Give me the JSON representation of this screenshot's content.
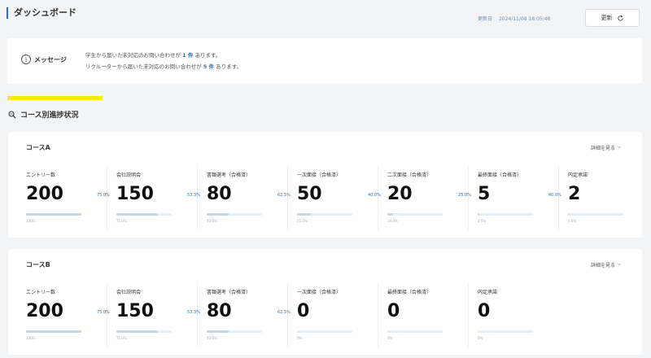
{
  "header": {
    "title": "ダッシュボード",
    "updated_label": "更新日",
    "updated_value": "2024/11/08 18:05:48",
    "refresh_label": "更新"
  },
  "message": {
    "label": "メッセージ",
    "line1_prefix": "学生から届いた未対応のお問い合わせが",
    "line1_count": "1 件",
    "line1_suffix": "あります。",
    "line2_prefix": "リクルーターから届いた未対応のお問い合わせが",
    "line2_count": "5 件",
    "line2_suffix": "あります。"
  },
  "section": {
    "title": "コース別進捗状況"
  },
  "courses": [
    {
      "name": "コースA",
      "detail_label": "詳細を見る",
      "stages": [
        {
          "label": "エントリー数",
          "value": "200",
          "bar": 1.0,
          "foot": "100%"
        },
        {
          "label": "会社説明会",
          "value": "150",
          "bar": 0.75,
          "foot": "75.0%"
        },
        {
          "label": "書類選考（合格済）",
          "value": "80",
          "bar": 0.4,
          "foot": "40.0%"
        },
        {
          "label": "一次面接（合格済）",
          "value": "50",
          "bar": 0.25,
          "foot": "25.0%"
        },
        {
          "label": "二次面接（合格済）",
          "value": "20",
          "bar": 0.1,
          "foot": "10.0%"
        },
        {
          "label": "最終面接（合格済）",
          "value": "5",
          "bar": 0.025,
          "foot": "2.5%"
        },
        {
          "label": "内定承諾",
          "value": "2",
          "bar": 0.01,
          "foot": "1.0%"
        }
      ],
      "conversions": [
        "75.0%",
        "53.3%",
        "62.5%",
        "40.0%",
        "25.0%",
        "40.0%"
      ]
    },
    {
      "name": "コースB",
      "detail_label": "詳細を見る",
      "stages": [
        {
          "label": "エントリー数",
          "value": "200",
          "bar": 1.0,
          "foot": "100%"
        },
        {
          "label": "会社説明会",
          "value": "150",
          "bar": 0.75,
          "foot": "75.0%"
        },
        {
          "label": "書類選考（合格済）",
          "value": "80",
          "bar": 0.4,
          "foot": "40.0%"
        },
        {
          "label": "一次面接（合格済）",
          "value": "0",
          "bar": 0,
          "foot": "0%"
        },
        {
          "label": "最終面接（合格済）",
          "value": "0",
          "bar": 0,
          "foot": "0%"
        },
        {
          "label": "内定承諾",
          "value": "0",
          "bar": 0,
          "foot": "0%"
        }
      ],
      "conversions": [
        "75.0%",
        "53.3%",
        "62.5%"
      ]
    }
  ]
}
